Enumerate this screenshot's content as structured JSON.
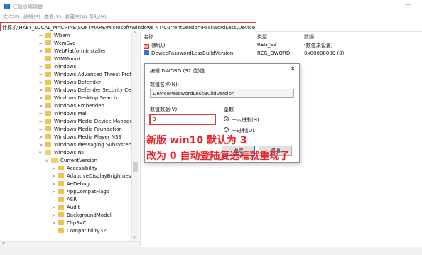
{
  "window": {
    "title": "注册表编辑器",
    "min_glyph": "—"
  },
  "menu": [
    "文件(F)",
    "编辑(E)",
    "查看(V)",
    "收藏夹(A)",
    "帮助(H)"
  ],
  "address": "计算机\\HKEY_LOCAL_MACHINE\\SOFTWARE\\Microsoft\\Windows NT\\CurrentVersion\\PasswordLess\\Device",
  "tree": {
    "items": [
      {
        "label": "Wbem",
        "chev": ">",
        "indent": 0
      },
      {
        "label": "WcmSvc",
        "chev": ">",
        "indent": 0
      },
      {
        "label": "WebPlatformInstaller",
        "chev": ">",
        "indent": 0
      },
      {
        "label": "WIMMount",
        "chev": "",
        "indent": 0
      },
      {
        "label": "Windows",
        "chev": ">",
        "indent": 0
      },
      {
        "label": "Windows Advanced Threat Protect",
        "chev": ">",
        "indent": 0
      },
      {
        "label": "Windows Defender",
        "chev": ">",
        "indent": 0
      },
      {
        "label": "Windows Defender Security Cente",
        "chev": ">",
        "indent": 0
      },
      {
        "label": "Windows Desktop Search",
        "chev": ">",
        "indent": 0
      },
      {
        "label": "Windows Embedded",
        "chev": ">",
        "indent": 0
      },
      {
        "label": "Windows Mail",
        "chev": ">",
        "indent": 0
      },
      {
        "label": "Windows Media Device Manager",
        "chev": ">",
        "indent": 0
      },
      {
        "label": "Windows Media Foundation",
        "chev": ">",
        "indent": 0
      },
      {
        "label": "Windows Media Player NSS",
        "chev": ">",
        "indent": 0
      },
      {
        "label": "Windows Messaging Subsystem",
        "chev": ">",
        "indent": 0
      },
      {
        "label": "Windows NT",
        "chev": "v",
        "indent": 0
      },
      {
        "label": "CurrentVersion",
        "chev": "v",
        "indent": 1
      },
      {
        "label": "Accessibility",
        "chev": ">",
        "indent": 2
      },
      {
        "label": "AdaptiveDisplayBrightness",
        "chev": ">",
        "indent": 2
      },
      {
        "label": "AeDebug",
        "chev": ">",
        "indent": 2
      },
      {
        "label": "AppCompatFlags",
        "chev": ">",
        "indent": 2
      },
      {
        "label": "ASR",
        "chev": "",
        "indent": 2
      },
      {
        "label": "Audit",
        "chev": ">",
        "indent": 2
      },
      {
        "label": "BackgroundModel",
        "chev": ">",
        "indent": 2
      },
      {
        "label": "ClipSVC",
        "chev": ">",
        "indent": 2
      },
      {
        "label": "Compatibility32",
        "chev": "",
        "indent": 2
      }
    ]
  },
  "list": {
    "headers": {
      "name": "名称",
      "type": "类型",
      "data": "数据"
    },
    "rows": [
      {
        "icon": "ab",
        "name": "(默认)",
        "type": "REG_SZ",
        "data": "(数值未设置)"
      },
      {
        "icon": "bin",
        "name": "DevicePasswordLessBuildVersion",
        "type": "REG_DWORD",
        "data": "0x00000000 (0)"
      }
    ]
  },
  "dialog": {
    "title": "编辑 DWORD (32 位)值",
    "close": "✕",
    "name_label": "数值名称(N):",
    "name_value": "DevicePasswordLessBuildVersion",
    "data_label": "数值数据(V):",
    "data_value": "3",
    "base_label": "基数",
    "hex_label": "十六进制(H)",
    "dec_label": "十进制(D)",
    "ok": "确定",
    "cancel": "取消"
  },
  "annotations": {
    "line1": "新版 win10 默认为 3",
    "line2": "改为 0 自动登陆复选框就重现了"
  },
  "colors": {
    "accent_red": "#e23a3a",
    "annotation_red": "#e8242a",
    "folder": "#f2c14e"
  }
}
